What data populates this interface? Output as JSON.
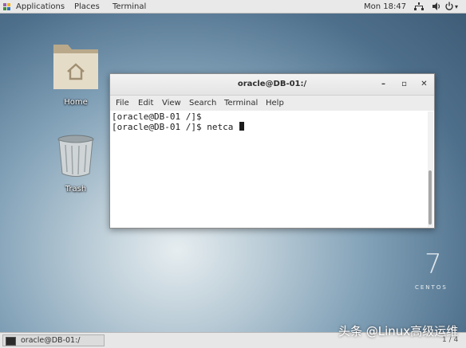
{
  "topbar": {
    "applications": "Applications",
    "places": "Places",
    "terminal": "Terminal",
    "clock": "Mon 18:47"
  },
  "desktop": {
    "home_label": "Home",
    "trash_label": "Trash"
  },
  "window": {
    "title": "oracle@DB-01:/",
    "menu": [
      "File",
      "Edit",
      "View",
      "Search",
      "Terminal",
      "Help"
    ],
    "lines": [
      "[oracle@DB-01 /]$",
      "[oracle@DB-01 /]$ netca "
    ]
  },
  "logo": {
    "number": "7",
    "name": "CENTOS"
  },
  "taskbar": {
    "item": "oracle@DB-01:/",
    "pager": "1 / 4"
  },
  "watermark": "头条 @Linux高级运维",
  "colors": {
    "topbar": "#e9e9e9",
    "window_bg": "#ffffff",
    "text": "#2e2e2e"
  }
}
